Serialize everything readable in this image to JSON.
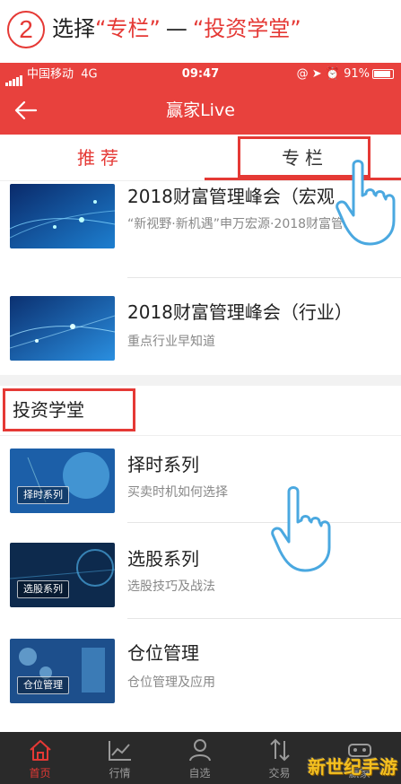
{
  "instruction": {
    "step_number": "2",
    "prefix": "选择",
    "target1": "“专栏”",
    "separator": "—",
    "target2": "“投资学堂”"
  },
  "status_bar": {
    "carrier": "中国移动",
    "network": "4G",
    "time": "09:47",
    "battery": "91%"
  },
  "nav": {
    "title": "赢家Live",
    "back_icon": "back-arrow-icon"
  },
  "tabs": [
    {
      "label": "推荐"
    },
    {
      "label": "专栏"
    }
  ],
  "column_items": [
    {
      "title": "2018财富管理峰会（宏观",
      "desc": "“新视野·新机遇”申万宏源·2018财富管理峰会"
    },
    {
      "title": "2018财富管理峰会（行业）",
      "desc": "重点行业早知道"
    }
  ],
  "section": {
    "title": "投资学堂"
  },
  "school_items": [
    {
      "title": "择时系列",
      "desc": "买卖时机如何选择",
      "thumb_label": "择时系列"
    },
    {
      "title": "选股系列",
      "desc": "选股技巧及战法",
      "thumb_label": "选股系列"
    },
    {
      "title": "仓位管理",
      "desc": "仓位管理及应用",
      "thumb_label": "仓位管理"
    }
  ],
  "bottom_tabs": [
    {
      "label": "首页",
      "icon": "home-icon"
    },
    {
      "label": "行情",
      "icon": "chart-icon"
    },
    {
      "label": "自选",
      "icon": "person-icon"
    },
    {
      "label": "交易",
      "icon": "trade-arrows-icon"
    },
    {
      "label": "赢家",
      "icon": "vr-icon"
    }
  ],
  "watermark": "新世纪手游",
  "colors": {
    "brand_red": "#e8413d",
    "highlight_red": "#e53935",
    "tabbar_bg": "#2a2a2a"
  }
}
